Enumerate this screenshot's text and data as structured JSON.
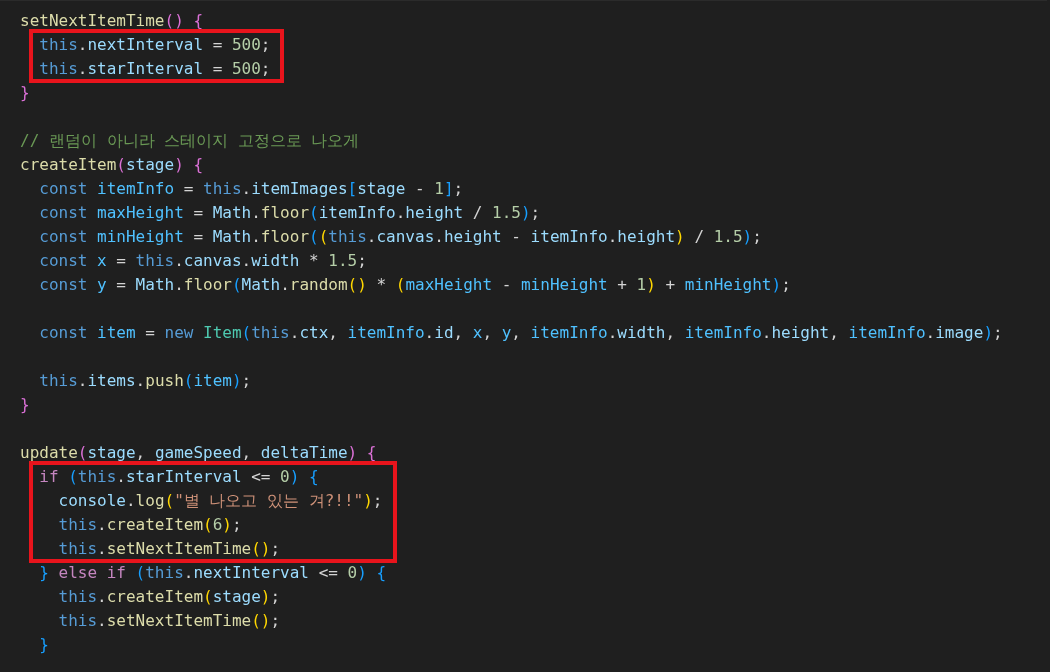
{
  "groups": [
    {
      "lines": [
        {
          "framed": false,
          "tokens": [
            {
              "kind": "function",
              "text": "setNextItemTime"
            },
            {
              "kind": "bracket2",
              "text": "()"
            },
            {
              "kind": "bracket2",
              "text": " {"
            }
          ],
          "groups": [
            {
              "lines": [
                {
                  "framed": true,
                  "tokens": [
                    {
                      "kind": "keyword",
                      "text": "this"
                    },
                    {
                      "kind": "plain",
                      "text": "."
                    },
                    {
                      "kind": "variable",
                      "text": "nextInterval"
                    },
                    {
                      "kind": "plain",
                      "text": " = "
                    },
                    {
                      "kind": "number",
                      "text": "500"
                    },
                    {
                      "kind": "plain",
                      "text": ";"
                    }
                  ]
                },
                {
                  "framed": true,
                  "tokens": [
                    {
                      "kind": "keyword",
                      "text": "this"
                    },
                    {
                      "kind": "plain",
                      "text": "."
                    },
                    {
                      "kind": "variable",
                      "text": "starInterval"
                    },
                    {
                      "kind": "plain",
                      "text": " = "
                    },
                    {
                      "kind": "number",
                      "text": "500"
                    },
                    {
                      "kind": "plain",
                      "text": ";"
                    }
                  ]
                }
              ]
            }
          ]
        },
        {
          "framed": false,
          "tokens": [
            {
              "kind": "bracket2",
              "text": "}"
            }
          ]
        }
      ]
    },
    {
      "lines": [
        {
          "framed": false,
          "tokens": [
            {
              "kind": "comment",
              "text": "// 랜덤이 아니라 스테이지 고정으로 나오게"
            }
          ]
        },
        {
          "framed": false,
          "tokens": [
            {
              "kind": "function",
              "text": "createItem"
            },
            {
              "kind": "bracket2",
              "text": "("
            },
            {
              "kind": "variable",
              "text": "stage"
            },
            {
              "kind": "bracket2",
              "text": ")"
            },
            {
              "kind": "bracket2",
              "text": " {"
            }
          ],
          "groups": [
            {
              "lines": [
                {
                  "framed": false,
                  "tokens": [
                    {
                      "kind": "keyword",
                      "text": "const "
                    },
                    {
                      "kind": "constant",
                      "text": "itemInfo"
                    },
                    {
                      "kind": "plain",
                      "text": " = "
                    },
                    {
                      "kind": "keyword",
                      "text": "this"
                    },
                    {
                      "kind": "plain",
                      "text": "."
                    },
                    {
                      "kind": "variable",
                      "text": "itemImages"
                    },
                    {
                      "kind": "bracket3",
                      "text": "["
                    },
                    {
                      "kind": "variable",
                      "text": "stage"
                    },
                    {
                      "kind": "plain",
                      "text": " - "
                    },
                    {
                      "kind": "number",
                      "text": "1"
                    },
                    {
                      "kind": "bracket3",
                      "text": "]"
                    },
                    {
                      "kind": "plain",
                      "text": ";"
                    }
                  ]
                },
                {
                  "framed": false,
                  "tokens": [
                    {
                      "kind": "keyword",
                      "text": "const "
                    },
                    {
                      "kind": "constant",
                      "text": "maxHeight"
                    },
                    {
                      "kind": "plain",
                      "text": " = "
                    },
                    {
                      "kind": "variable",
                      "text": "Math"
                    },
                    {
                      "kind": "plain",
                      "text": "."
                    },
                    {
                      "kind": "function",
                      "text": "floor"
                    },
                    {
                      "kind": "bracket3",
                      "text": "("
                    },
                    {
                      "kind": "variable",
                      "text": "itemInfo"
                    },
                    {
                      "kind": "plain",
                      "text": "."
                    },
                    {
                      "kind": "variable",
                      "text": "height"
                    },
                    {
                      "kind": "plain",
                      "text": " / "
                    },
                    {
                      "kind": "number",
                      "text": "1.5"
                    },
                    {
                      "kind": "bracket3",
                      "text": ")"
                    },
                    {
                      "kind": "plain",
                      "text": ";"
                    }
                  ]
                },
                {
                  "framed": false,
                  "tokens": [
                    {
                      "kind": "keyword",
                      "text": "const "
                    },
                    {
                      "kind": "constant",
                      "text": "minHeight"
                    },
                    {
                      "kind": "plain",
                      "text": " = "
                    },
                    {
                      "kind": "variable",
                      "text": "Math"
                    },
                    {
                      "kind": "plain",
                      "text": "."
                    },
                    {
                      "kind": "function",
                      "text": "floor"
                    },
                    {
                      "kind": "bracket3",
                      "text": "("
                    },
                    {
                      "kind": "bracket1",
                      "text": "("
                    },
                    {
                      "kind": "keyword",
                      "text": "this"
                    },
                    {
                      "kind": "plain",
                      "text": "."
                    },
                    {
                      "kind": "variable",
                      "text": "canvas"
                    },
                    {
                      "kind": "plain",
                      "text": "."
                    },
                    {
                      "kind": "variable",
                      "text": "height"
                    },
                    {
                      "kind": "plain",
                      "text": " - "
                    },
                    {
                      "kind": "variable",
                      "text": "itemInfo"
                    },
                    {
                      "kind": "plain",
                      "text": "."
                    },
                    {
                      "kind": "variable",
                      "text": "height"
                    },
                    {
                      "kind": "bracket1",
                      "text": ")"
                    },
                    {
                      "kind": "plain",
                      "text": " / "
                    },
                    {
                      "kind": "number",
                      "text": "1.5"
                    },
                    {
                      "kind": "bracket3",
                      "text": ")"
                    },
                    {
                      "kind": "plain",
                      "text": ";"
                    }
                  ]
                },
                {
                  "framed": false,
                  "tokens": [
                    {
                      "kind": "keyword",
                      "text": "const "
                    },
                    {
                      "kind": "constant",
                      "text": "x"
                    },
                    {
                      "kind": "plain",
                      "text": " = "
                    },
                    {
                      "kind": "keyword",
                      "text": "this"
                    },
                    {
                      "kind": "plain",
                      "text": "."
                    },
                    {
                      "kind": "variable",
                      "text": "canvas"
                    },
                    {
                      "kind": "plain",
                      "text": "."
                    },
                    {
                      "kind": "variable",
                      "text": "width"
                    },
                    {
                      "kind": "plain",
                      "text": " * "
                    },
                    {
                      "kind": "number",
                      "text": "1.5"
                    },
                    {
                      "kind": "plain",
                      "text": ";"
                    }
                  ]
                },
                {
                  "framed": false,
                  "tokens": [
                    {
                      "kind": "keyword",
                      "text": "const "
                    },
                    {
                      "kind": "constant",
                      "text": "y"
                    },
                    {
                      "kind": "plain",
                      "text": " = "
                    },
                    {
                      "kind": "variable",
                      "text": "Math"
                    },
                    {
                      "kind": "plain",
                      "text": "."
                    },
                    {
                      "kind": "function",
                      "text": "floor"
                    },
                    {
                      "kind": "bracket3",
                      "text": "("
                    },
                    {
                      "kind": "variable",
                      "text": "Math"
                    },
                    {
                      "kind": "plain",
                      "text": "."
                    },
                    {
                      "kind": "function",
                      "text": "random"
                    },
                    {
                      "kind": "bracket1",
                      "text": "()"
                    },
                    {
                      "kind": "plain",
                      "text": " * "
                    },
                    {
                      "kind": "bracket1",
                      "text": "("
                    },
                    {
                      "kind": "constant",
                      "text": "maxHeight"
                    },
                    {
                      "kind": "plain",
                      "text": " - "
                    },
                    {
                      "kind": "constant",
                      "text": "minHeight"
                    },
                    {
                      "kind": "plain",
                      "text": " + "
                    },
                    {
                      "kind": "number",
                      "text": "1"
                    },
                    {
                      "kind": "bracket1",
                      "text": ")"
                    },
                    {
                      "kind": "plain",
                      "text": " + "
                    },
                    {
                      "kind": "constant",
                      "text": "minHeight"
                    },
                    {
                      "kind": "bracket3",
                      "text": ")"
                    },
                    {
                      "kind": "plain",
                      "text": ";"
                    }
                  ]
                }
              ]
            },
            {
              "lines": [
                {
                  "framed": false,
                  "tokens": [
                    {
                      "kind": "keyword",
                      "text": "const "
                    },
                    {
                      "kind": "constant",
                      "text": "item"
                    },
                    {
                      "kind": "plain",
                      "text": " = "
                    },
                    {
                      "kind": "keyword",
                      "text": "new "
                    },
                    {
                      "kind": "class",
                      "text": "Item"
                    },
                    {
                      "kind": "bracket3",
                      "text": "("
                    },
                    {
                      "kind": "keyword",
                      "text": "this"
                    },
                    {
                      "kind": "plain",
                      "text": "."
                    },
                    {
                      "kind": "variable",
                      "text": "ctx"
                    },
                    {
                      "kind": "plain",
                      "text": ", "
                    },
                    {
                      "kind": "constant",
                      "text": "itemInfo"
                    },
                    {
                      "kind": "plain",
                      "text": "."
                    },
                    {
                      "kind": "variable",
                      "text": "id"
                    },
                    {
                      "kind": "plain",
                      "text": ", "
                    },
                    {
                      "kind": "constant",
                      "text": "x"
                    },
                    {
                      "kind": "plain",
                      "text": ", "
                    },
                    {
                      "kind": "constant",
                      "text": "y"
                    },
                    {
                      "kind": "plain",
                      "text": ", "
                    },
                    {
                      "kind": "constant",
                      "text": "itemInfo"
                    },
                    {
                      "kind": "plain",
                      "text": "."
                    },
                    {
                      "kind": "variable",
                      "text": "width"
                    },
                    {
                      "kind": "plain",
                      "text": ", "
                    },
                    {
                      "kind": "constant",
                      "text": "itemInfo"
                    },
                    {
                      "kind": "plain",
                      "text": "."
                    },
                    {
                      "kind": "variable",
                      "text": "height"
                    },
                    {
                      "kind": "plain",
                      "text": ", "
                    },
                    {
                      "kind": "constant",
                      "text": "itemInfo"
                    },
                    {
                      "kind": "plain",
                      "text": "."
                    },
                    {
                      "kind": "variable",
                      "text": "image"
                    },
                    {
                      "kind": "bracket3",
                      "text": ")"
                    },
                    {
                      "kind": "plain",
                      "text": ";"
                    }
                  ]
                }
              ]
            },
            {
              "lines": [
                {
                  "framed": false,
                  "tokens": [
                    {
                      "kind": "keyword",
                      "text": "this"
                    },
                    {
                      "kind": "plain",
                      "text": "."
                    },
                    {
                      "kind": "variable",
                      "text": "items"
                    },
                    {
                      "kind": "plain",
                      "text": "."
                    },
                    {
                      "kind": "function",
                      "text": "push"
                    },
                    {
                      "kind": "bracket3",
                      "text": "("
                    },
                    {
                      "kind": "constant",
                      "text": "item"
                    },
                    {
                      "kind": "bracket3",
                      "text": ")"
                    },
                    {
                      "kind": "plain",
                      "text": ";"
                    }
                  ]
                }
              ]
            }
          ]
        },
        {
          "framed": false,
          "tokens": [
            {
              "kind": "bracket2",
              "text": "}"
            }
          ]
        }
      ]
    },
    {
      "lines": [
        {
          "framed": false,
          "tokens": [
            {
              "kind": "function",
              "text": "update"
            },
            {
              "kind": "bracket2",
              "text": "("
            },
            {
              "kind": "variable",
              "text": "stage"
            },
            {
              "kind": "plain",
              "text": ", "
            },
            {
              "kind": "variable",
              "text": "gameSpeed"
            },
            {
              "kind": "plain",
              "text": ", "
            },
            {
              "kind": "variable",
              "text": "deltaTime"
            },
            {
              "kind": "bracket2",
              "text": ")"
            },
            {
              "kind": "bracket2",
              "text": " {"
            }
          ],
          "groups": [
            {
              "lines": [
                {
                  "framed": true,
                  "tokens": [
                    {
                      "kind": "control",
                      "text": "if "
                    },
                    {
                      "kind": "bracket3",
                      "text": "("
                    },
                    {
                      "kind": "keyword",
                      "text": "this"
                    },
                    {
                      "kind": "plain",
                      "text": "."
                    },
                    {
                      "kind": "variable",
                      "text": "starInterval"
                    },
                    {
                      "kind": "plain",
                      "text": " <= "
                    },
                    {
                      "kind": "number",
                      "text": "0"
                    },
                    {
                      "kind": "bracket3",
                      "text": ")"
                    },
                    {
                      "kind": "bracket3",
                      "text": " {"
                    }
                  ],
                  "groups": [
                    {
                      "lines": [
                        {
                          "framed": true,
                          "tokens": [
                            {
                              "kind": "variable",
                              "text": "console"
                            },
                            {
                              "kind": "plain",
                              "text": "."
                            },
                            {
                              "kind": "function",
                              "text": "log"
                            },
                            {
                              "kind": "bracket1",
                              "text": "("
                            },
                            {
                              "kind": "string",
                              "text": "\"별 나오고 있는 겨?!!\""
                            },
                            {
                              "kind": "bracket1",
                              "text": ")"
                            },
                            {
                              "kind": "plain",
                              "text": ";"
                            }
                          ]
                        },
                        {
                          "framed": true,
                          "tokens": [
                            {
                              "kind": "keyword",
                              "text": "this"
                            },
                            {
                              "kind": "plain",
                              "text": "."
                            },
                            {
                              "kind": "function",
                              "text": "createItem"
                            },
                            {
                              "kind": "bracket1",
                              "text": "("
                            },
                            {
                              "kind": "number",
                              "text": "6"
                            },
                            {
                              "kind": "bracket1",
                              "text": ")"
                            },
                            {
                              "kind": "plain",
                              "text": ";"
                            }
                          ]
                        },
                        {
                          "framed": true,
                          "tokens": [
                            {
                              "kind": "keyword",
                              "text": "this"
                            },
                            {
                              "kind": "plain",
                              "text": "."
                            },
                            {
                              "kind": "function",
                              "text": "setNextItemTime"
                            },
                            {
                              "kind": "bracket1",
                              "text": "()"
                            },
                            {
                              "kind": "plain",
                              "text": ";"
                            }
                          ]
                        }
                      ]
                    }
                  ]
                },
                {
                  "framed": false,
                  "tokens": [
                    {
                      "kind": "bracket3",
                      "text": "} "
                    },
                    {
                      "kind": "control",
                      "text": "else if "
                    },
                    {
                      "kind": "bracket3",
                      "text": "("
                    },
                    {
                      "kind": "keyword",
                      "text": "this"
                    },
                    {
                      "kind": "plain",
                      "text": "."
                    },
                    {
                      "kind": "variable",
                      "text": "nextInterval"
                    },
                    {
                      "kind": "plain",
                      "text": " <= "
                    },
                    {
                      "kind": "number",
                      "text": "0"
                    },
                    {
                      "kind": "bracket3",
                      "text": ")"
                    },
                    {
                      "kind": "bracket3",
                      "text": " {"
                    }
                  ],
                  "groups": [
                    {
                      "lines": [
                        {
                          "framed": false,
                          "tokens": [
                            {
                              "kind": "keyword",
                              "text": "this"
                            },
                            {
                              "kind": "plain",
                              "text": "."
                            },
                            {
                              "kind": "function",
                              "text": "createItem"
                            },
                            {
                              "kind": "bracket1",
                              "text": "("
                            },
                            {
                              "kind": "variable",
                              "text": "stage"
                            },
                            {
                              "kind": "bracket1",
                              "text": ")"
                            },
                            {
                              "kind": "plain",
                              "text": ";"
                            }
                          ]
                        },
                        {
                          "framed": false,
                          "tokens": [
                            {
                              "kind": "keyword",
                              "text": "this"
                            },
                            {
                              "kind": "plain",
                              "text": "."
                            },
                            {
                              "kind": "function",
                              "text": "setNextItemTime"
                            },
                            {
                              "kind": "bracket1",
                              "text": "()"
                            },
                            {
                              "kind": "plain",
                              "text": ";"
                            }
                          ]
                        }
                      ]
                    }
                  ]
                },
                {
                  "framed": false,
                  "tokens": [
                    {
                      "kind": "bracket3",
                      "text": "}"
                    }
                  ]
                }
              ]
            }
          ]
        }
      ]
    }
  ]
}
